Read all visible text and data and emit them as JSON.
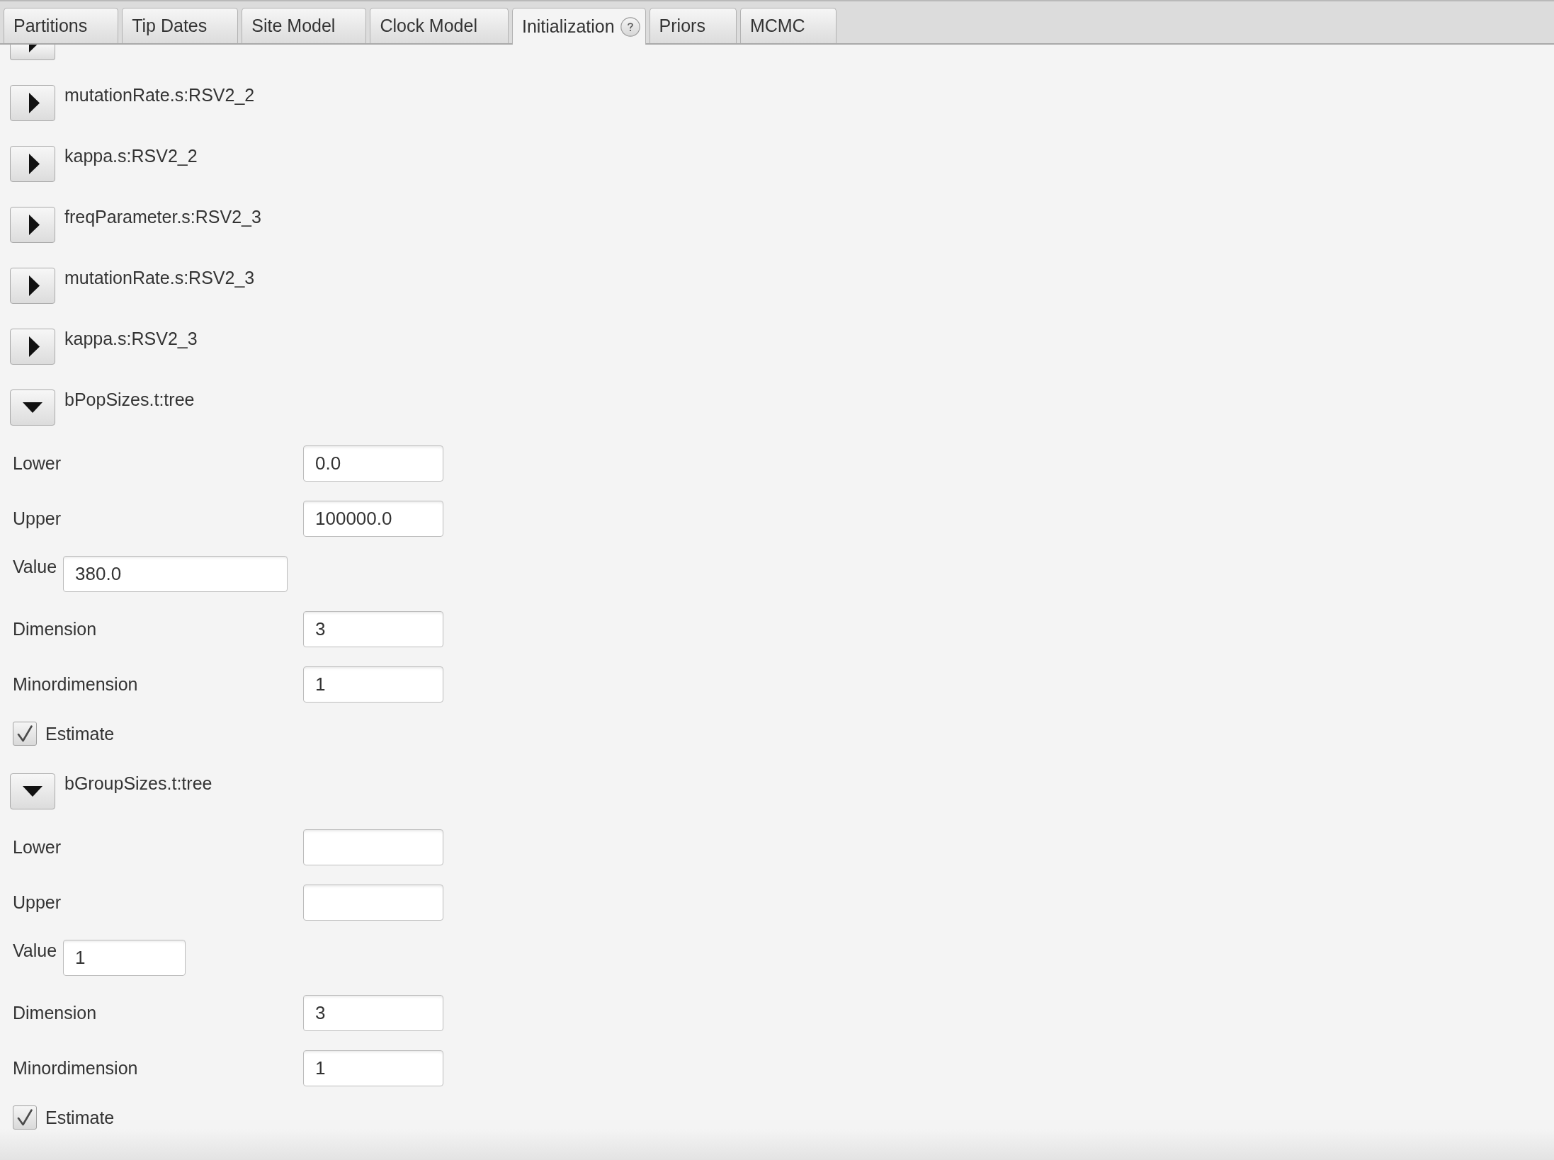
{
  "tabs": [
    {
      "label": "Partitions",
      "selected": false,
      "help": false
    },
    {
      "label": "Tip Dates",
      "selected": false,
      "help": false
    },
    {
      "label": "Site Model",
      "selected": false,
      "help": false
    },
    {
      "label": "Clock Model",
      "selected": false,
      "help": false
    },
    {
      "label": "Initialization",
      "selected": true,
      "help": true
    },
    {
      "label": "Priors",
      "selected": false,
      "help": false
    },
    {
      "label": "MCMC",
      "selected": false,
      "help": false
    }
  ],
  "parameters": [
    {
      "expanded": false
    },
    {
      "label": "mutationRate.s:RSV2_2",
      "expanded": false
    },
    {
      "label": "kappa.s:RSV2_2",
      "expanded": false
    },
    {
      "label": "freqParameter.s:RSV2_3",
      "expanded": false
    },
    {
      "label": "mutationRate.s:RSV2_3",
      "expanded": false
    },
    {
      "label": "kappa.s:RSV2_3",
      "expanded": false
    },
    {
      "label": "bPopSizes.t:tree",
      "expanded": true,
      "fields": [
        {
          "kind": "aligned",
          "label": "Lower",
          "value": "0.0"
        },
        {
          "kind": "aligned",
          "label": "Upper",
          "value": "100000.0"
        },
        {
          "kind": "inline",
          "label": "Value",
          "value": "380.0"
        },
        {
          "kind": "aligned",
          "label": "Dimension",
          "value": "3"
        },
        {
          "kind": "aligned",
          "label": "Minordimension",
          "value": "1"
        }
      ],
      "estimate": {
        "label": "Estimate",
        "checked": true
      }
    },
    {
      "label": "bGroupSizes.t:tree",
      "expanded": true,
      "fields": [
        {
          "kind": "aligned",
          "label": "Lower"
        },
        {
          "kind": "aligned",
          "label": "Upper"
        },
        {
          "kind": "inline",
          "label": "Value",
          "value": "1"
        },
        {
          "kind": "aligned",
          "label": "Dimension",
          "value": "3"
        },
        {
          "kind": "aligned",
          "label": "Minordimension",
          "value": "1"
        }
      ],
      "estimate": {
        "label": "Estimate",
        "checked": true
      }
    }
  ]
}
